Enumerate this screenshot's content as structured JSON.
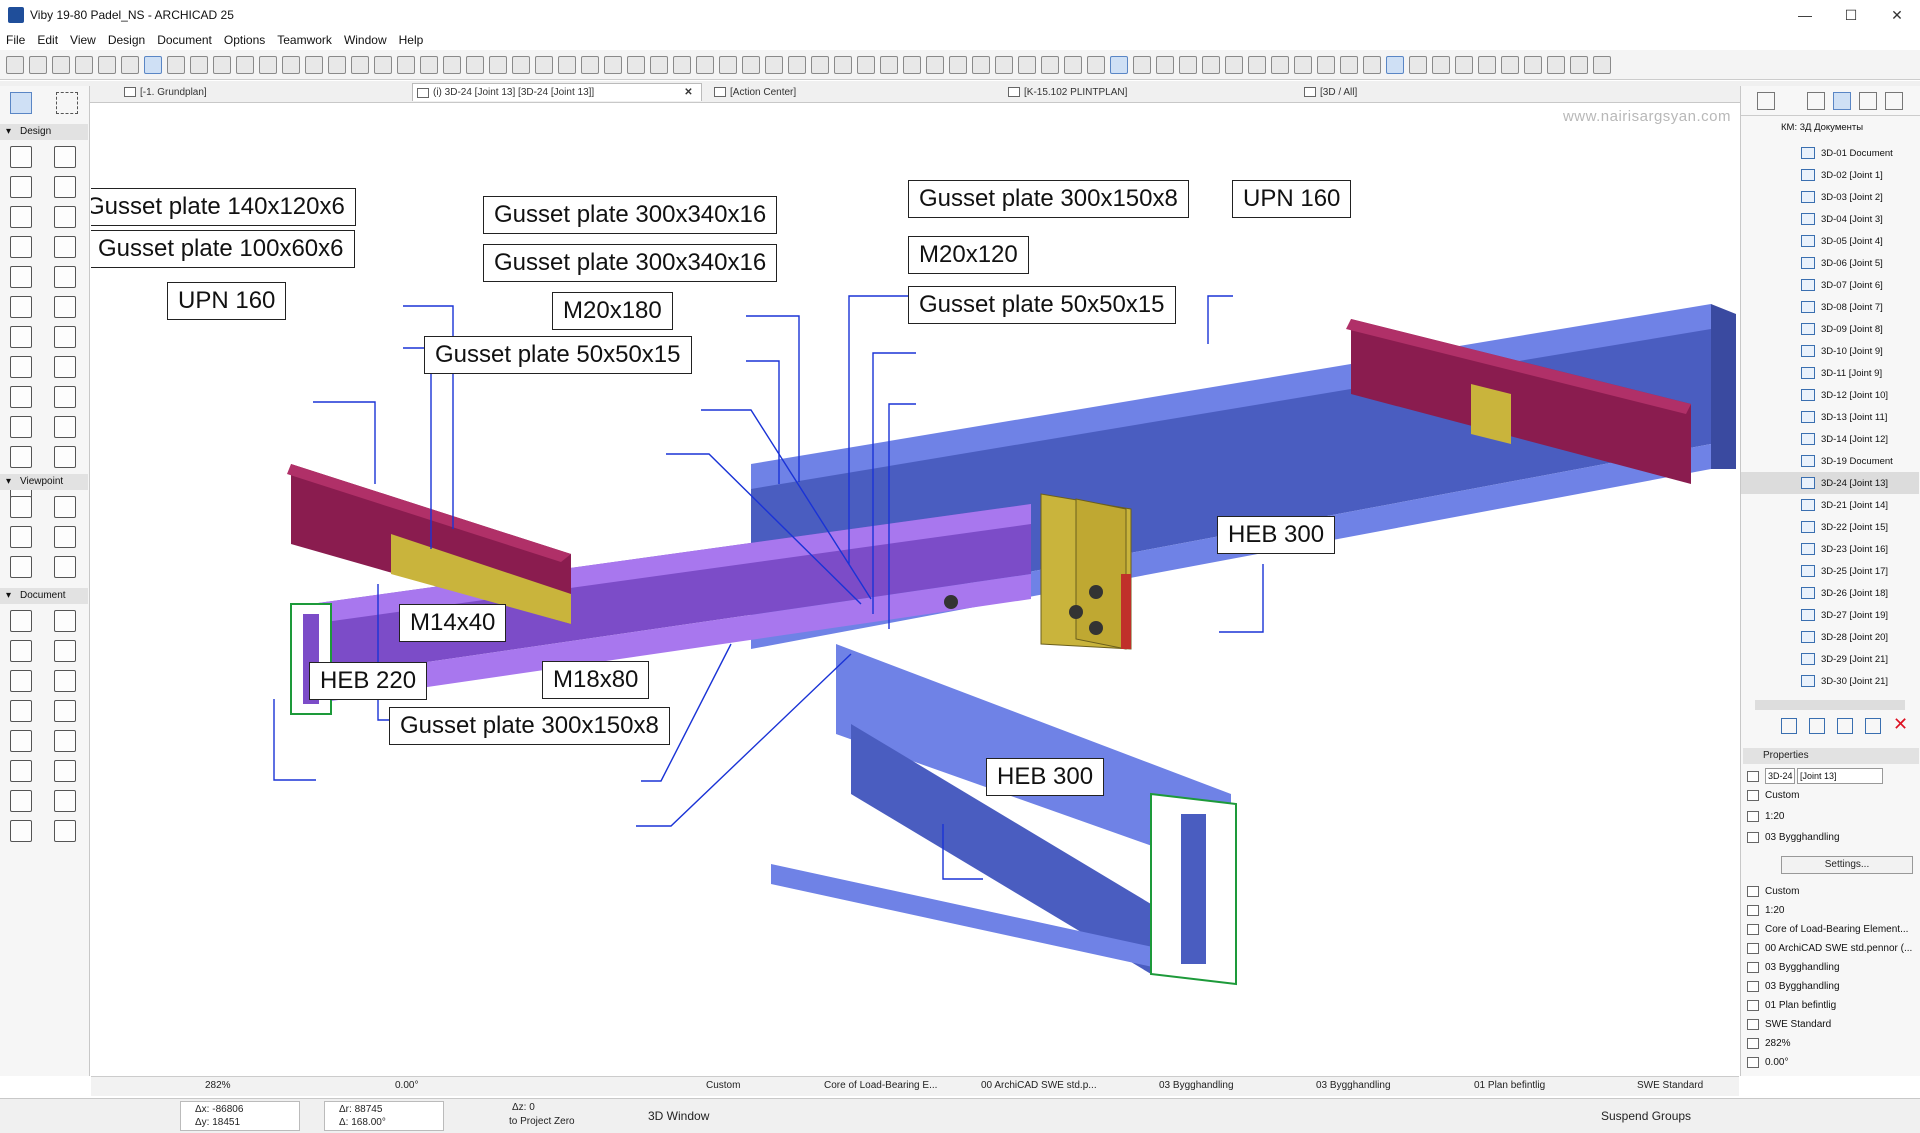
{
  "window": {
    "title": "Viby 19-80 Padel_NS - ARCHICAD 25",
    "minimize": "—",
    "maximize": "☐",
    "close": "✕"
  },
  "menu": [
    "File",
    "Edit",
    "View",
    "Design",
    "Document",
    "Options",
    "Teamwork",
    "Window",
    "Help"
  ],
  "tabs": [
    {
      "label": "[-1. Grundplan]"
    },
    {
      "label": "(i) 3D-24 [Joint 13] [3D-24 [Joint 13]]",
      "close": "✕"
    },
    {
      "label": "[Action Center]"
    },
    {
      "label": "[K-15.102 PLINTPLAN]"
    },
    {
      "label": "[3D / All]"
    }
  ],
  "toolbox": {
    "sections": [
      "Design",
      "Viewpoint",
      "Document"
    ]
  },
  "canvas": {
    "watermark": "www.nairisargsyan.com",
    "labels": {
      "gp140": "Gusset plate 140x120x6",
      "gp100": "Gusset plate 100x60x6",
      "upn_left": "UPN 160",
      "gp300a": "Gusset plate 300x340x16",
      "gp300b": "Gusset plate 300x340x16",
      "m20x180": "M20x180",
      "gp50_left": "Gusset plate 50x50x15",
      "gp300x150_top": "Gusset plate 300x150x8",
      "m20x120": "M20x120",
      "gp50_right": "Gusset plate 50x50x15",
      "upn_right": "UPN 160",
      "heb300_right": "HEB 300",
      "m14x40": "M14x40",
      "heb220": "HEB 220",
      "m18x80": "M18x80",
      "gp300x150_bottom": "Gusset plate 300x150x8",
      "heb300_bottom": "HEB 300"
    }
  },
  "navigator": {
    "root": "КМ: 3Д Документы",
    "items": [
      "3D-01 Document",
      "3D-02 [Joint 1]",
      "3D-03 [Joint 2]",
      "3D-04 [Joint 3]",
      "3D-05 [Joint 4]",
      "3D-06 [Joint 5]",
      "3D-07 [Joint 6]",
      "3D-08 [Joint 7]",
      "3D-09 [Joint 8]",
      "3D-10 [Joint 9]",
      "3D-11 [Joint 9]",
      "3D-12 [Joint 10]",
      "3D-13 [Joint 11]",
      "3D-14 [Joint 12]",
      "3D-19 Document",
      "3D-24 [Joint 13]",
      "3D-21 [Joint 14]",
      "3D-22 [Joint 15]",
      "3D-23 [Joint 16]",
      "3D-25 [Joint 17]",
      "3D-26 [Joint 18]",
      "3D-27 [Joint 19]",
      "3D-28 [Joint 20]",
      "3D-29 [Joint 21]",
      "3D-30 [Joint 21]"
    ],
    "selected_index": 15
  },
  "properties": {
    "title": "Properties",
    "id": "3D-24",
    "name": "[Joint 13]",
    "rows_top": [
      "Custom",
      "1:20",
      "03 Bygghandling"
    ],
    "settings_button": "Settings...",
    "rows_bottom": [
      "Custom",
      "1:20",
      "Core of Load-Bearing Element...",
      "00 ArchiCAD SWE std.pennor (...",
      "03 Bygghandling",
      "03 Bygghandling",
      "01 Plan befintlig",
      "SWE Standard",
      "282%",
      "0.00°"
    ]
  },
  "statusbar": {
    "zoom": "282%",
    "angle": "0.00°",
    "scale_custom": "Custom",
    "structure": "Core of Load-Bearing E...",
    "pens": "00 ArchiCAD SWE std.p...",
    "layer1": "03 Bygghandling",
    "layer2": "03 Bygghandling",
    "renovation": "01 Plan befintlig",
    "mvo": "SWE Standard"
  },
  "bottombar": {
    "dx": "Δx: -86806",
    "dy": "Δy: 18451",
    "dr": "Δr: 88745",
    "da": "Δ: 168.00°",
    "dz": "Δz: 0",
    "to_zero": "to Project Zero",
    "window_3d": "3D Window",
    "suspend": "Suspend Groups"
  },
  "colors": {
    "heb": "#5b6fd6",
    "heb_dark": "#3f4fa8",
    "upn": "#8a1c4f",
    "heb220": "#8b55d0",
    "plate": "#c9b43c",
    "leader": "#1a33d6"
  }
}
